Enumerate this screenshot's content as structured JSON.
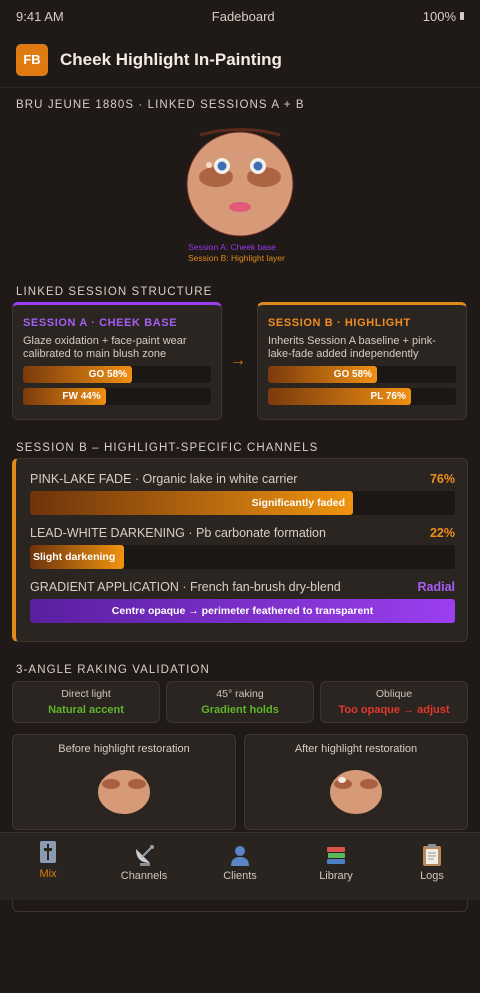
{
  "status": {
    "time": "9:41 AM",
    "carrier": "Fadeboard",
    "battery": "100%"
  },
  "header": {
    "badge": "FB",
    "title": "Cheek Highlight In-Painting"
  },
  "doll_section": {
    "label": "BRU JEUNE 1880S · LINKED SESSIONS A + B",
    "legend_a": "Session A: Cheek base",
    "legend_b": "Session B: Highlight layer"
  },
  "structure": {
    "label": "LINKED SESSION STRUCTURE",
    "session_a": {
      "title": "SESSION A · CHEEK BASE",
      "desc": "Glaze oxidation + face-paint wear calibrated to main blush zone",
      "bars": [
        {
          "label": "GO 58%",
          "value": 58
        },
        {
          "label": "FW 44%",
          "value": 44
        }
      ]
    },
    "arrow": "→",
    "session_b": {
      "title": "SESSION B · HIGHLIGHT",
      "desc": "Inherits Session A baseline + pink-lake-fade added independently",
      "bars": [
        {
          "label": "GO 58%",
          "value": 58
        },
        {
          "label": "PL 76%",
          "value": 76
        }
      ]
    }
  },
  "channels": {
    "label": "SESSION B – HIGHLIGHT-SPECIFIC CHANNELS",
    "items": [
      {
        "name": "PINK-LAKE FADE · Organic lake in white carrier",
        "value": "76%",
        "fill": 76,
        "bar_text": "Significantly faded"
      },
      {
        "name": "LEAD-WHITE DARKENING · Pb carbonate formation",
        "value": "22%",
        "fill": 22,
        "bar_text": "Slight darkening"
      },
      {
        "name": "GRADIENT APPLICATION · French fan-brush dry-blend",
        "value": "Radial",
        "bar_text": "Centre opaque → perimeter feathered to transparent"
      }
    ]
  },
  "validation": {
    "label": "3-ANGLE RAKING VALIDATION",
    "angles": [
      {
        "name": "Direct light",
        "status": "Natural accent",
        "color": "#5fb52a"
      },
      {
        "name": "45° raking",
        "status": "Gradient holds",
        "color": "#5fb52a"
      },
      {
        "name": "Oblique",
        "status": "Too opaque → adjust",
        "color": "#e0392b"
      }
    ],
    "before_label": "Before highlight restoration",
    "after_label": "After highlight restoration"
  },
  "tabs": [
    {
      "label": "Mix",
      "icon": "mix-icon",
      "active": true
    },
    {
      "label": "Channels",
      "icon": "satellite-dish-icon",
      "active": false
    },
    {
      "label": "Clients",
      "icon": "person-icon",
      "active": false
    },
    {
      "label": "Library",
      "icon": "books-icon",
      "active": false
    },
    {
      "label": "Logs",
      "icon": "clipboard-icon",
      "active": false
    }
  ],
  "colors": {
    "accent": "#e07b12",
    "session_a": "#9b3ff0",
    "session_b": "#e08a1a",
    "background": "#1f1a17"
  }
}
